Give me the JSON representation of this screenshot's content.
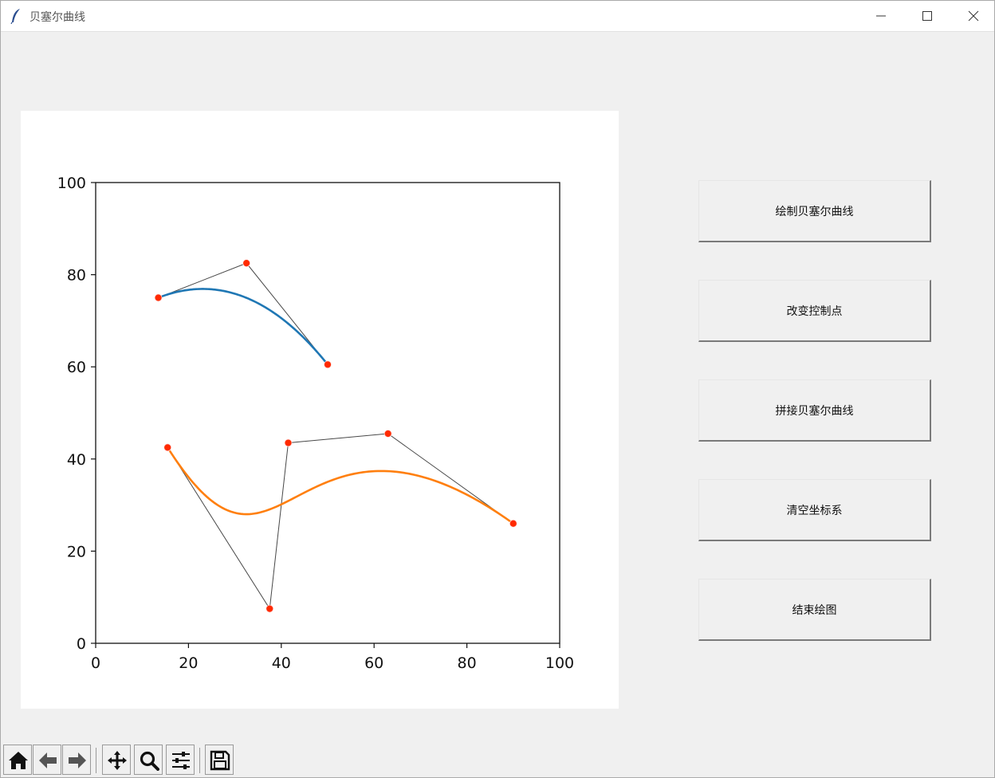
{
  "window": {
    "title": "贝塞尔曲线",
    "controls": [
      "minimize-icon",
      "maximize-icon",
      "close-icon"
    ]
  },
  "buttons": [
    {
      "label": "绘制贝塞尔曲线"
    },
    {
      "label": "改变控制点"
    },
    {
      "label": "拼接贝塞尔曲线"
    },
    {
      "label": "清空坐标系"
    },
    {
      "label": "结束绘图"
    }
  ],
  "toolbar": {
    "icons": [
      "home-icon",
      "back-icon",
      "forward-icon",
      "pan-icon",
      "zoom-icon",
      "configure-subplots-icon",
      "save-icon"
    ]
  },
  "colors": {
    "curve1": "#1f77b4",
    "curve2": "#ff7f0e",
    "control_point": "#ff2a00",
    "control_polygon": "#333333"
  },
  "chart_data": {
    "type": "line",
    "xlim": [
      0,
      100
    ],
    "ylim": [
      0,
      100
    ],
    "xticks": [
      "0",
      "20",
      "40",
      "60",
      "80",
      "100"
    ],
    "yticks": [
      "0",
      "20",
      "40",
      "60",
      "80",
      "100"
    ],
    "grid": false,
    "series": [
      {
        "kind": "bezier",
        "color": "#1f77b4",
        "control_points": [
          [
            13.5,
            75
          ],
          [
            32.5,
            82.5
          ],
          [
            50,
            60.5
          ]
        ]
      },
      {
        "kind": "bezier",
        "color": "#ff7f0e",
        "control_points": [
          [
            15.5,
            42.5
          ],
          [
            37.5,
            7.5
          ],
          [
            41.5,
            43.5
          ],
          [
            63,
            45.5
          ],
          [
            90,
            26
          ]
        ]
      }
    ]
  }
}
